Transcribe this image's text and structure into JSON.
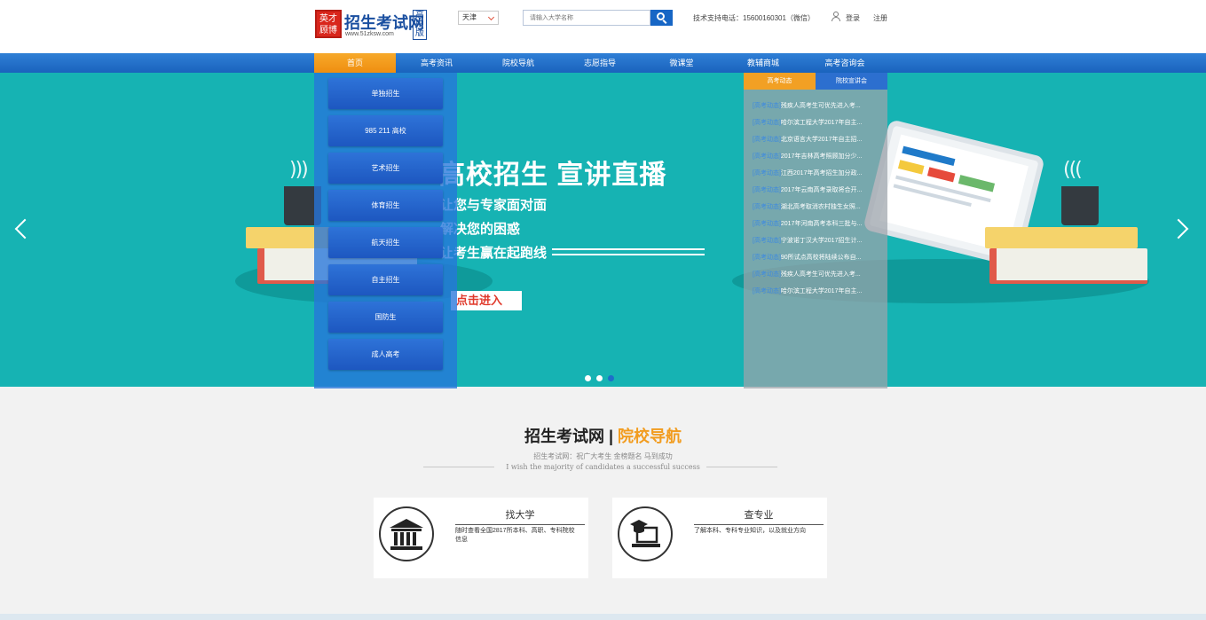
{
  "header": {
    "logo": {
      "seal_text": "英才\n顾博",
      "main": "招生考试网",
      "url": "www.51zksw.com",
      "side": "高\n中\n版"
    },
    "city": "天津",
    "search_placeholder": "请输入大学名称",
    "support": "技术支持电话：15600160301（微信）",
    "login": "登录",
    "register": "注册"
  },
  "nav": {
    "items": [
      "首页",
      "高考资讯",
      "院校导航",
      "志愿指导",
      "微课堂",
      "教辅商城",
      "高考咨询会"
    ]
  },
  "banner": {
    "title": "高校招生 宣讲直播",
    "lines": [
      "让您与专家面对面",
      "解决您的困惑",
      "让考生赢在起跑线"
    ],
    "enter": "点击进入",
    "slide_count": 3,
    "active_slide": 2
  },
  "left_menu": {
    "items": [
      "单独招生",
      "985 211 高校",
      "艺术招生",
      "体育招生",
      "航天招生",
      "自主招生",
      "国防生",
      "成人高考"
    ]
  },
  "news": {
    "tabs": [
      "高考动态",
      "院校宣讲会"
    ],
    "tag": "[高考动态]",
    "items": [
      "残疾人高考生可优先进入考...",
      "哈尔滨工程大学2017年自主...",
      "北京语言大学2017年自主招...",
      "2017年吉林高考照顾加分少...",
      "江西2017年高考招生加分政...",
      "2017年云南高考录取将合开...",
      "湖北高考取消农村独生女照...",
      "2017年河南高考本科三批与...",
      "宁波诺丁汉大学2017招生计...",
      "90所试点高校将陆续公布自...",
      "残疾人高考生可优先进入考...",
      "哈尔滨工程大学2017年自主..."
    ]
  },
  "section": {
    "title_main": "招生考试网 | ",
    "title_highlight": "院校导航",
    "subtitle": "招生考试网：祝广大考生  金榜题名  马到成功",
    "subtitle_en": "I wish the majority of candidates a successful success"
  },
  "cards": [
    {
      "title": "找大学",
      "desc": "随时查看全国2817所本科、高职、专科院校信息",
      "icon": "university-icon"
    },
    {
      "title": "查专业",
      "desc": "了解本科、专科专业知识，以及就业方向",
      "icon": "graduate-laptop-icon"
    }
  ],
  "colors": {
    "nav": "#1a63bd",
    "active": "#f29c1f",
    "banner": "#16b3b3"
  }
}
